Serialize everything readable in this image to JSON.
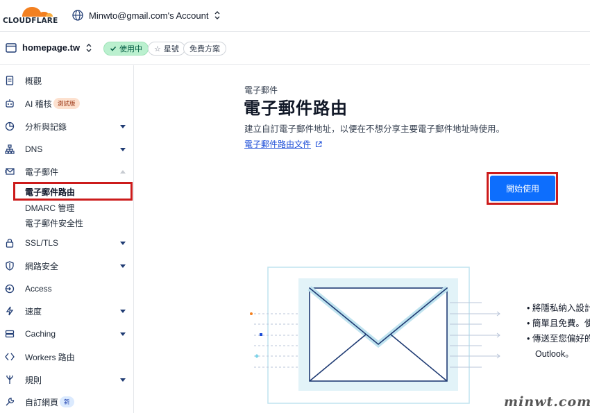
{
  "brand": {
    "name": "CLOUDFLARE",
    "accent": "#f38020"
  },
  "account": {
    "name": "Minwto@gmail.com's Account"
  },
  "zone": {
    "domain": "homepage.tw",
    "status_label": "使用中",
    "star_label": "星號",
    "plan_label": "免費方案"
  },
  "sidebar": {
    "items": [
      {
        "label": "概觀",
        "icon": "document-icon"
      },
      {
        "label": "AI 稽核",
        "icon": "robot-icon",
        "badge": "測試版"
      },
      {
        "label": "分析與記錄",
        "icon": "pie-chart-icon"
      },
      {
        "label": "DNS",
        "icon": "network-icon"
      },
      {
        "label": "電子郵件",
        "icon": "envelope-icon"
      },
      {
        "label": "SSL/TLS",
        "icon": "lock-icon"
      },
      {
        "label": "網路安全",
        "icon": "shield-icon"
      },
      {
        "label": "Access",
        "icon": "access-icon"
      },
      {
        "label": "速度",
        "icon": "bolt-icon"
      },
      {
        "label": "Caching",
        "icon": "storage-icon"
      },
      {
        "label": "Workers 路由",
        "icon": "code-icon"
      },
      {
        "label": "規則",
        "icon": "fork-icon"
      },
      {
        "label": "自訂網頁",
        "icon": "wrench-icon",
        "badge": "新"
      }
    ],
    "email_sub": [
      {
        "label": "電子郵件路由"
      },
      {
        "label": "DMARC 管理"
      },
      {
        "label": "電子郵件安全性"
      }
    ]
  },
  "main": {
    "breadcrumb": "電子郵件",
    "title": "電子郵件路由",
    "description": "建立自訂電子郵件地址，以便在不想分享主要電子郵件地址時使用。",
    "doc_link": "電子郵件路由文件",
    "start_button": "開始使用",
    "bullets": [
      "• 將隱私納入設計",
      "• 簡單且免費。使",
      "• 傳送至您偏好的",
      "Outlook。"
    ]
  },
  "watermark": "minwt.com"
}
